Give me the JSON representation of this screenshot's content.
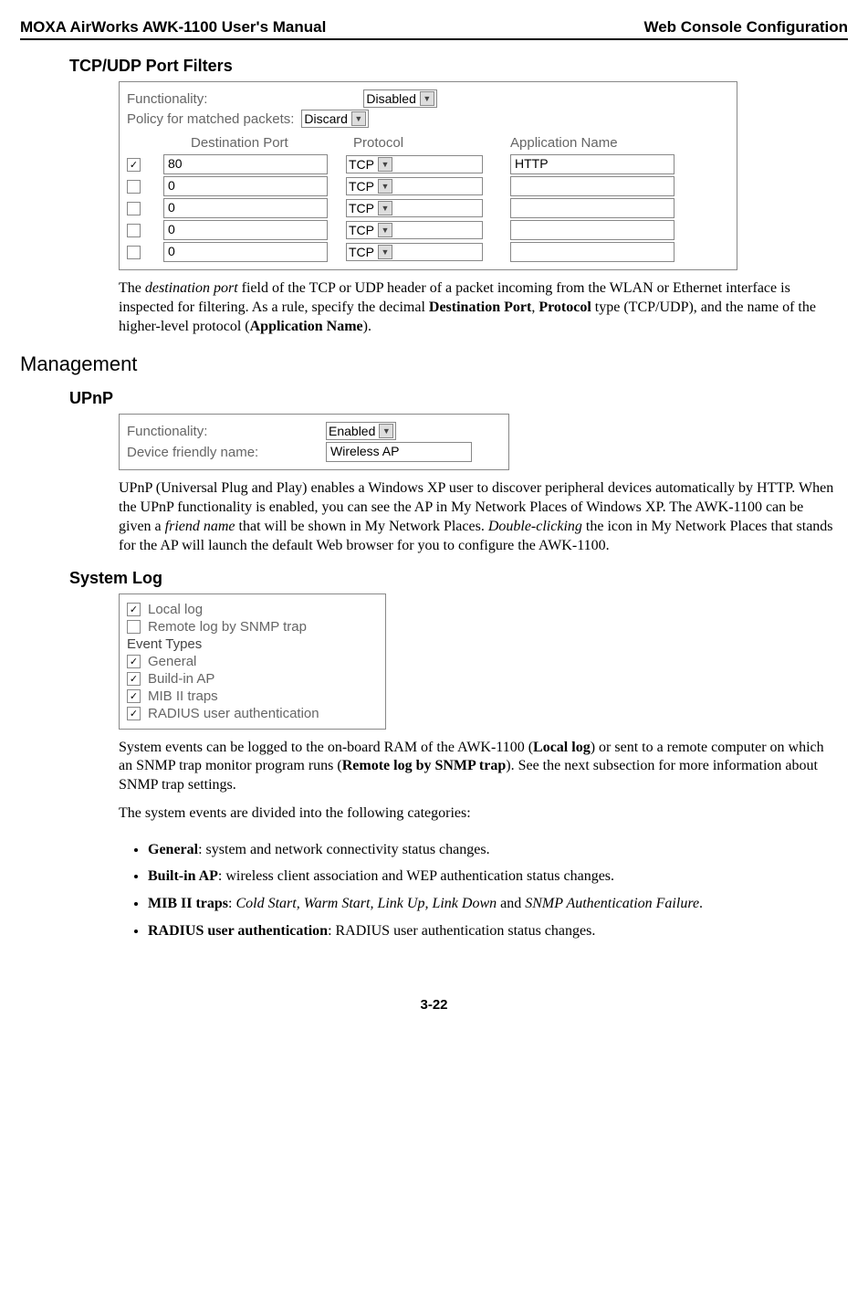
{
  "header": {
    "left": "MOXA AirWorks AWK-1100 User's Manual",
    "right": "Web Console Configuration"
  },
  "sec_tcp": {
    "title": "TCP/UDP Port Filters",
    "func_label": "Functionality:",
    "func_val": "Disabled",
    "policy_label": "Policy for matched packets:",
    "policy_val": "Discard",
    "cols": {
      "dest": "Destination Port",
      "proto": "Protocol",
      "app": "Application Name"
    },
    "rows": [
      {
        "checked": true,
        "port": "80",
        "proto": "TCP",
        "app": "HTTP"
      },
      {
        "checked": false,
        "port": "0",
        "proto": "TCP",
        "app": ""
      },
      {
        "checked": false,
        "port": "0",
        "proto": "TCP",
        "app": ""
      },
      {
        "checked": false,
        "port": "0",
        "proto": "TCP",
        "app": ""
      },
      {
        "checked": false,
        "port": "0",
        "proto": "TCP",
        "app": ""
      }
    ],
    "para_a": "The ",
    "para_b": "destination port",
    "para_c": " field of the TCP or UDP header of a packet incoming from the WLAN or Ethernet interface is inspected for filtering. As a rule, specify the decimal ",
    "para_d": "Destination Port",
    "para_e": ", ",
    "para_f": "Protocol",
    "para_g": " type (TCP/UDP), and the name of the higher-level protocol (",
    "para_h": "Application Name",
    "para_i": ")."
  },
  "sec_mgmt": {
    "title": "Management"
  },
  "sec_upnp": {
    "title": "UPnP",
    "func_label": "Functionality:",
    "func_val": "Enabled",
    "name_label": "Device friendly name:",
    "name_val": "Wireless AP",
    "p1": "UPnP (Universal Plug and Play) enables a Windows XP user to discover peripheral devices automatically by HTTP. When the UPnP functionality is enabled, you can see the AP in My Network Places of Windows XP. The AWK-1100 can be given a ",
    "p1b": "friend name",
    "p1c": " that will be shown in My Network Places. ",
    "p1d": "Double-clicking",
    "p1e": " the icon in My Network Places that stands for the AP will launch the default Web browser for you to configure the AWK-1100."
  },
  "sec_syslog": {
    "title": "System Log",
    "opts": {
      "local": {
        "checked": true,
        "label": "Local log"
      },
      "remote": {
        "checked": false,
        "label": "Remote log by SNMP trap"
      }
    },
    "ev_head": "Event Types",
    "ev": [
      {
        "checked": true,
        "label": "General"
      },
      {
        "checked": true,
        "label": "Build-in AP"
      },
      {
        "checked": true,
        "label": "MIB II traps"
      },
      {
        "checked": true,
        "label": "RADIUS user authentication"
      }
    ],
    "p2a": "System events can be logged to the on-board RAM of the AWK-1100 (",
    "p2b": "Local log",
    "p2c": ") or sent to a remote computer on which an SNMP trap monitor program runs (",
    "p2d": "Remote log by SNMP trap",
    "p2e": "). See the next subsection for more information about SNMP trap settings.",
    "p3": "The system events are divided into the following categories:",
    "bullets": [
      {
        "b": "General",
        "t": ": system and network connectivity status changes."
      },
      {
        "b": "Built-in AP",
        "t": ": wireless client association and WEP authentication status changes."
      },
      {
        "b": "MIB II traps",
        "t_pre": ": ",
        "i": "Cold Start, Warm Start, Link Up, Link Down",
        "t_mid": " and ",
        "i2": "SNMP Authentication Failure",
        "t_post": "."
      },
      {
        "b": "RADIUS user authentication",
        "t": ": RADIUS user authentication status changes."
      }
    ]
  },
  "page_num": "3-22",
  "icons": {
    "check": "✓",
    "drop": "▼"
  }
}
